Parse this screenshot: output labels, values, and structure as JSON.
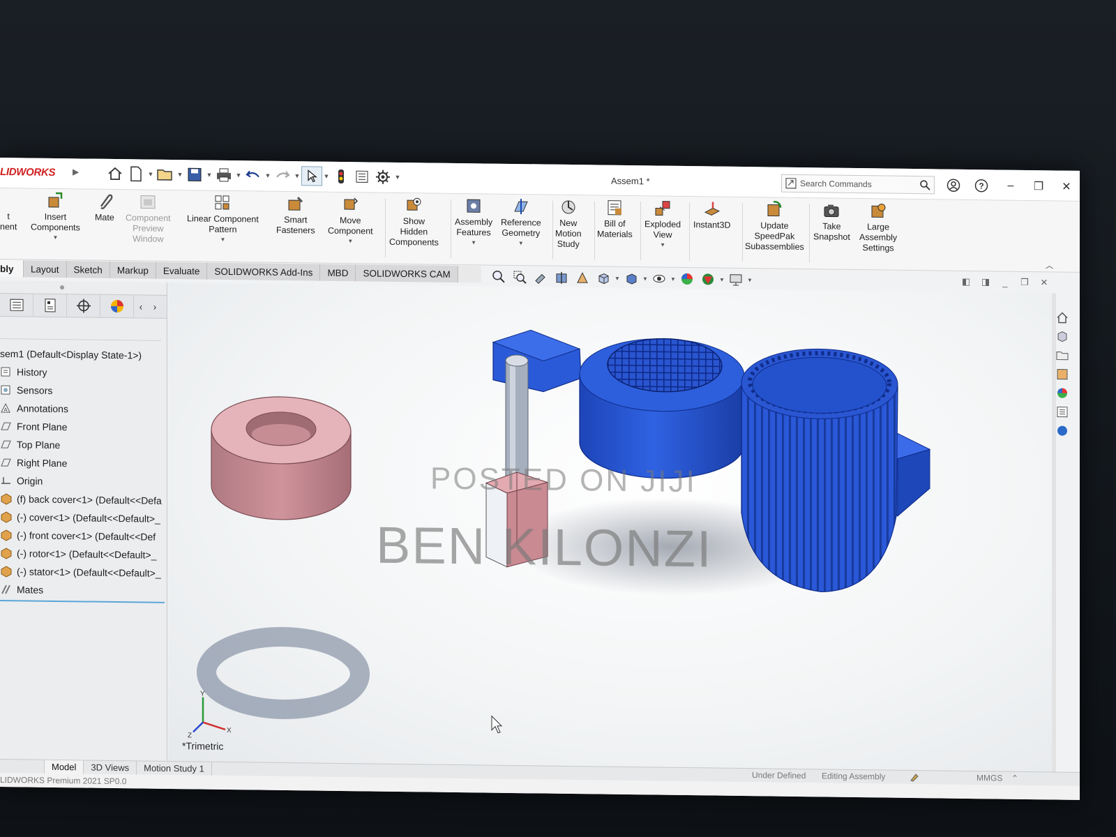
{
  "app": {
    "brand": "LIDWORKS",
    "document_title": "Assem1 *",
    "search_placeholder": "Search Commands"
  },
  "ribbon": {
    "items": [
      {
        "label": "t\nnent",
        "dim": false
      },
      {
        "label": "Insert\nComponents",
        "dim": false
      },
      {
        "label": "Mate",
        "dim": false
      },
      {
        "label": "Component\nPreview\nWindow",
        "dim": true
      },
      {
        "label": "Linear Component\nPattern",
        "dim": false
      },
      {
        "label": "Smart\nFasteners",
        "dim": false
      },
      {
        "label": "Move\nComponent",
        "dim": false
      },
      {
        "label": "Show\nHidden\nComponents",
        "dim": false
      },
      {
        "label": "Assembly\nFeatures",
        "dim": false
      },
      {
        "label": "Reference\nGeometry",
        "dim": false
      },
      {
        "label": "New\nMotion\nStudy",
        "dim": false
      },
      {
        "label": "Bill of\nMaterials",
        "dim": false
      },
      {
        "label": "Exploded\nView",
        "dim": false
      },
      {
        "label": "Instant3D",
        "dim": false
      },
      {
        "label": "Update\nSpeedPak\nSubassemblies",
        "dim": false
      },
      {
        "label": "Take\nSnapshot",
        "dim": false
      },
      {
        "label": "Large\nAssembly\nSettings",
        "dim": false
      }
    ]
  },
  "tabs": [
    "bly",
    "Layout",
    "Sketch",
    "Markup",
    "Evaluate",
    "SOLIDWORKS Add-Ins",
    "MBD",
    "SOLIDWORKS CAM"
  ],
  "tree": {
    "root": "sem1  (Default<Display State-1>)",
    "items": [
      "History",
      "Sensors",
      "Annotations",
      "Front Plane",
      "Top Plane",
      "Right Plane",
      "Origin"
    ],
    "components": [
      "(f) back cover<1> (Default<<Defa",
      "(-) cover<1> (Default<<Default>_",
      "(-) front cover<1> (Default<<Def",
      "(-) rotor<1> (Default<<Default>_",
      "(-) stator<1> (Default<<Default>_"
    ],
    "mates": "Mates"
  },
  "viewport": {
    "watermark_top": "POSTED ON JIJI",
    "watermark_main": "BEN KILONZI",
    "view_name": "*Trimetric"
  },
  "bottom_tabs": [
    "Model",
    "3D Views",
    "Motion Study 1"
  ],
  "status": {
    "left": "LIDWORKS Premium 2021 SP0.0",
    "state": "Under Defined",
    "mode": "Editing Assembly",
    "units": "MMGS"
  },
  "colors": {
    "brand_red": "#d02020",
    "part_blue": "#2457d6",
    "part_pink": "#d99aa0"
  },
  "icons": [
    "home-icon",
    "new-document-icon",
    "open-folder-icon",
    "save-icon",
    "print-icon",
    "undo-icon",
    "redo-icon",
    "select-icon",
    "rebuild-icon",
    "file-properties-icon",
    "options-icon"
  ]
}
